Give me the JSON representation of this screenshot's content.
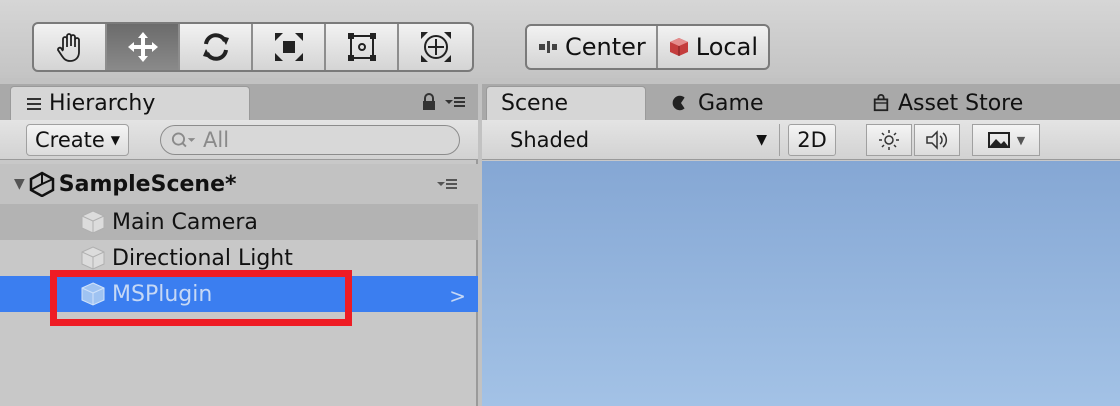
{
  "toolbar": {
    "tools": [
      {
        "name": "hand-tool",
        "icon": "hand-icon",
        "active": false
      },
      {
        "name": "move-tool",
        "icon": "move-arrows-icon",
        "active": true
      },
      {
        "name": "rotate-tool",
        "icon": "rotate-icon",
        "active": false
      },
      {
        "name": "scale-tool",
        "icon": "scale-icon",
        "active": false
      },
      {
        "name": "rect-tool",
        "icon": "rect-transform-icon",
        "active": false
      },
      {
        "name": "transform-tool",
        "icon": "transform-icon",
        "active": false
      }
    ],
    "pivot_label": "Center",
    "space_label": "Local"
  },
  "hierarchy": {
    "tab_label": "Hierarchy",
    "create_label": "Create",
    "search_placeholder": "All",
    "scene_name": "SampleScene*",
    "items": [
      {
        "label": "Main Camera"
      },
      {
        "label": "Directional Light"
      },
      {
        "label": "MSPlugin"
      }
    ],
    "selected_color": "#3b7ef0",
    "highlight_color": "#ee1c24"
  },
  "scene_view": {
    "tabs": [
      {
        "label": "Scene"
      },
      {
        "label": "Game"
      },
      {
        "label": "Asset Store"
      }
    ],
    "shading_mode": "Shaded",
    "mode_2d_label": "2D"
  }
}
